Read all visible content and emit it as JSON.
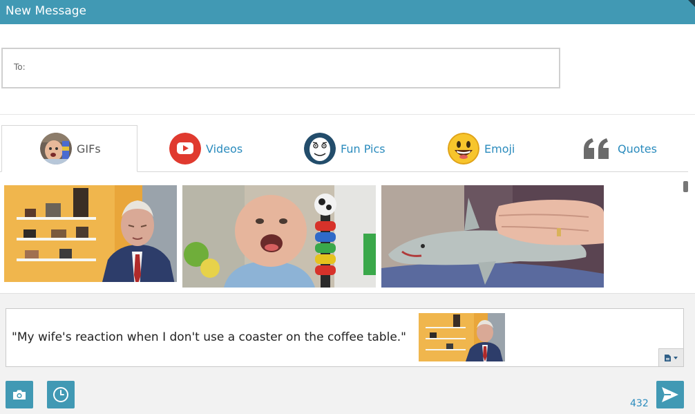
{
  "window": {
    "title": "New Message"
  },
  "recipient": {
    "label": "To:",
    "value": ""
  },
  "tabs": [
    {
      "label": "GIFs",
      "icon": "baby-face-icon",
      "active": true
    },
    {
      "label": "Videos",
      "icon": "youtube-play-icon",
      "active": false
    },
    {
      "label": "Fun Pics",
      "icon": "meme-face-icon",
      "active": false
    },
    {
      "label": "Emoji",
      "icon": "smiley-emoji-icon",
      "active": false
    },
    {
      "label": "Quotes",
      "icon": "quote-marks-icon",
      "active": false
    }
  ],
  "gallery": {
    "items": [
      {
        "kind": "gif",
        "subject": "man in suit",
        "caption_partial": "My wife's reaction when I don't..."
      },
      {
        "kind": "gif",
        "subject": "laughing baby"
      },
      {
        "kind": "gif",
        "subject": "toy shark and hand"
      }
    ]
  },
  "compose": {
    "text": "\"My wife's reaction when I don't use a coaster on the coffee table.\"",
    "attachment": "man in suit gif"
  },
  "footer": {
    "char_count": "432"
  },
  "colors": {
    "accent": "#4199b4",
    "link": "#2a8bbd"
  }
}
